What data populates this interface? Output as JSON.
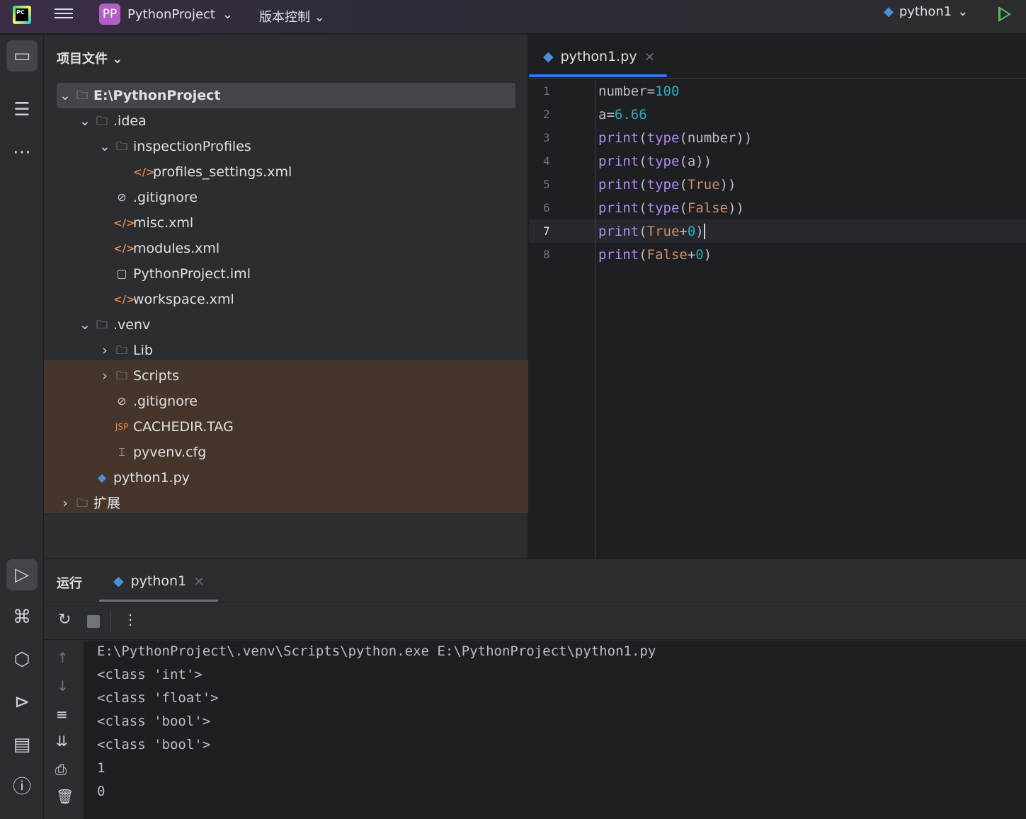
{
  "topbar": {
    "project": "PythonProject",
    "project_badge": "PP",
    "vcs": "版本控制",
    "run_config": "python1"
  },
  "project_panel": {
    "title": "项目文件"
  },
  "tree": [
    {
      "label": "E:\\PythonProject",
      "arrow": "⌄",
      "icon": "folder-icon",
      "indent": 0,
      "bold": true
    },
    {
      "label": ".idea",
      "arrow": "⌄",
      "icon": "folder-icon",
      "indent": 1
    },
    {
      "label": "inspectionProfiles",
      "arrow": "⌄",
      "icon": "folder-icon",
      "indent": 2
    },
    {
      "label": "profiles_settings.xml",
      "arrow": "",
      "icon": "xml-icon",
      "indent": 3
    },
    {
      "label": ".gitignore",
      "arrow": "",
      "icon": "ignore-icon",
      "indent": 2
    },
    {
      "label": "misc.xml",
      "arrow": "",
      "icon": "xml-icon",
      "indent": 2
    },
    {
      "label": "modules.xml",
      "arrow": "",
      "icon": "xml-icon",
      "indent": 2
    },
    {
      "label": "PythonProject.iml",
      "arrow": "",
      "icon": "module-file-icon",
      "indent": 2
    },
    {
      "label": "workspace.xml",
      "arrow": "",
      "icon": "xml-icon",
      "indent": 2
    },
    {
      "label": ".venv",
      "arrow": "⌄",
      "icon": "folder-icon",
      "indent": 1
    },
    {
      "label": "Lib",
      "arrow": "›",
      "icon": "folder-icon",
      "indent": 2
    },
    {
      "label": "Scripts",
      "arrow": "›",
      "icon": "folder-icon",
      "indent": 2
    },
    {
      "label": ".gitignore",
      "arrow": "",
      "icon": "ignore-icon",
      "indent": 2
    },
    {
      "label": "CACHEDIR.TAG",
      "arrow": "",
      "icon": "jsp-icon",
      "indent": 2
    },
    {
      "label": "pyvenv.cfg",
      "arrow": "",
      "icon": "config-icon",
      "indent": 2
    },
    {
      "label": "python1.py",
      "arrow": "",
      "icon": "python-icon",
      "indent": 1
    },
    {
      "label": "扩展",
      "arrow": "›",
      "icon": "folder-icon",
      "indent": 0
    }
  ],
  "editor": {
    "tab": "python1.py",
    "current_line": 7,
    "lines": [
      "1",
      "2",
      "3",
      "4",
      "5",
      "6",
      "7",
      "8"
    ]
  },
  "run": {
    "title": "运行",
    "tab": "python1",
    "output": [
      "E:\\PythonProject\\.venv\\Scripts\\python.exe E:\\PythonProject\\python1.py",
      "<class 'int'>",
      "<class 'float'>",
      "<class 'bool'>",
      "<class 'bool'>",
      "1",
      "0"
    ]
  }
}
